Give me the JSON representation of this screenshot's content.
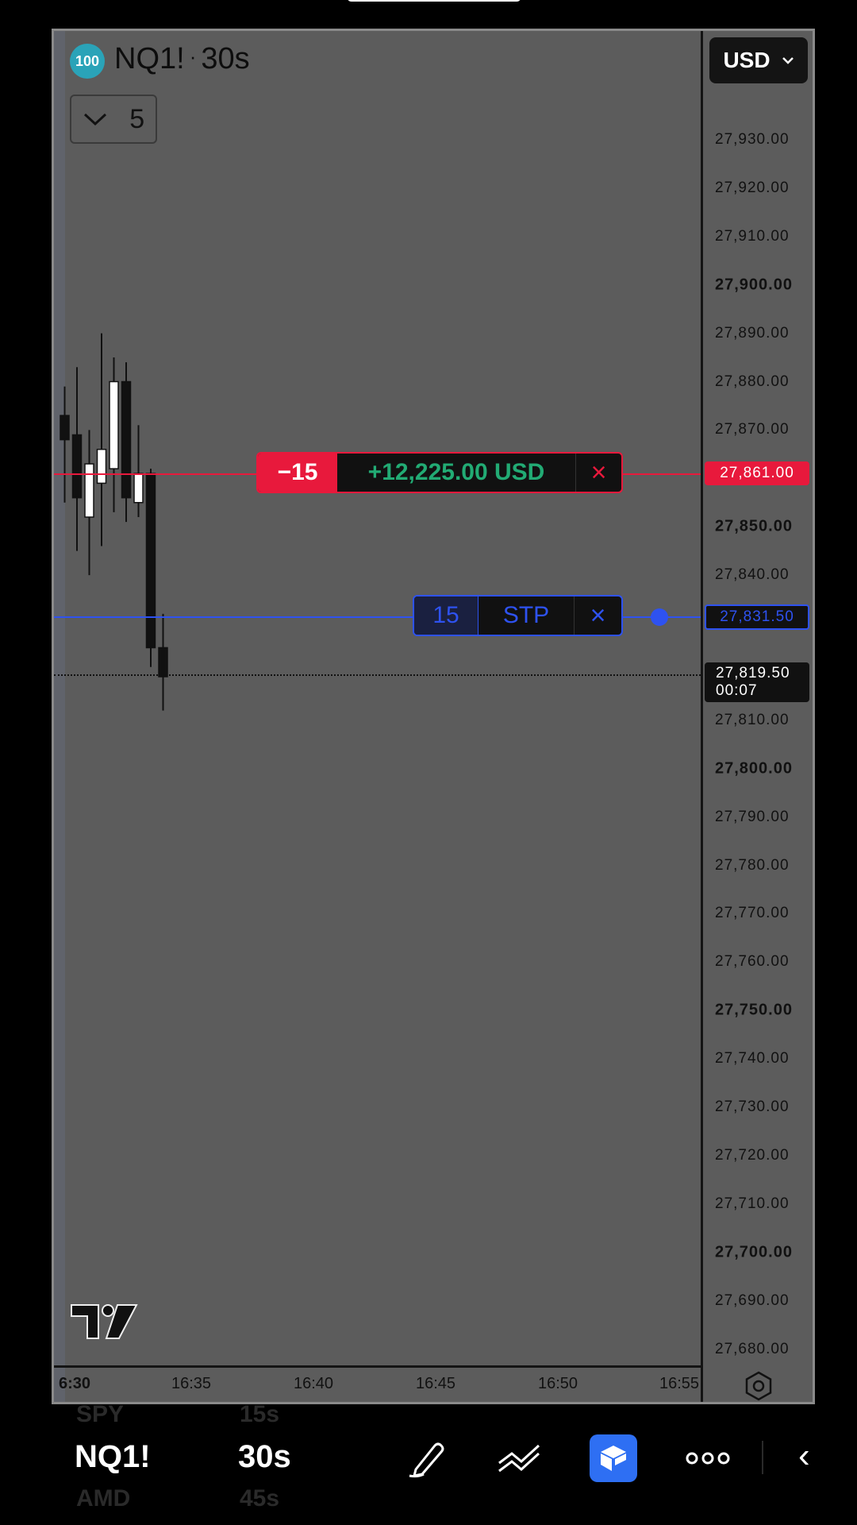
{
  "chart": {
    "symbol_badge": "100",
    "symbol": "NQ1!",
    "separator": "·",
    "interval": "30s",
    "indicators_count": "5",
    "currency": "USD",
    "price_labels": [
      {
        "text": "27,930.00",
        "bold": false
      },
      {
        "text": "27,920.00",
        "bold": false
      },
      {
        "text": "27,910.00",
        "bold": false
      },
      {
        "text": "27,900.00",
        "bold": true
      },
      {
        "text": "27,890.00",
        "bold": false
      },
      {
        "text": "27,880.00",
        "bold": false
      },
      {
        "text": "27,870.00",
        "bold": false
      },
      {
        "text": "27,850.00",
        "bold": true
      },
      {
        "text": "27,840.00",
        "bold": false
      },
      {
        "text": "27,810.00",
        "bold": false
      },
      {
        "text": "27,800.00",
        "bold": true
      },
      {
        "text": "27,790.00",
        "bold": false
      },
      {
        "text": "27,780.00",
        "bold": false
      },
      {
        "text": "27,770.00",
        "bold": false
      },
      {
        "text": "27,760.00",
        "bold": false
      },
      {
        "text": "27,750.00",
        "bold": true
      },
      {
        "text": "27,740.00",
        "bold": false
      },
      {
        "text": "27,730.00",
        "bold": false
      },
      {
        "text": "27,720.00",
        "bold": false
      },
      {
        "text": "27,710.00",
        "bold": false
      },
      {
        "text": "27,700.00",
        "bold": true
      },
      {
        "text": "27,690.00",
        "bold": false
      },
      {
        "text": "27,680.00",
        "bold": false
      }
    ],
    "time_labels": [
      {
        "text": "6:30",
        "bold": true
      },
      {
        "text": "16:35",
        "bold": false
      },
      {
        "text": "16:40",
        "bold": false
      },
      {
        "text": "16:45",
        "bold": false
      },
      {
        "text": "16:50",
        "bold": false
      },
      {
        "text": "16:55",
        "bold": false
      }
    ],
    "position": {
      "quantity": "−15",
      "pnl": "+12,225.00 USD",
      "close": "×",
      "price_tag": "27,861.00",
      "color": "#e8193c",
      "pnl_color": "#22ab74"
    },
    "stop_order": {
      "quantity": "15",
      "type": "STP",
      "close": "×",
      "price_tag": "27,831.50",
      "color": "#2e52f0"
    },
    "last_price": {
      "price": "27,819.50",
      "countdown": "00:07"
    },
    "candles": [
      {
        "open": 27873,
        "high": 27879,
        "low": 27855,
        "close": 27868
      },
      {
        "open": 27869,
        "high": 27883,
        "low": 27845,
        "close": 27856
      },
      {
        "open": 27852,
        "high": 27870,
        "low": 27840,
        "close": 27863
      },
      {
        "open": 27859,
        "high": 27890,
        "low": 27846,
        "close": 27866
      },
      {
        "open": 27862,
        "high": 27885,
        "low": 27853,
        "close": 27880
      },
      {
        "open": 27880,
        "high": 27884,
        "low": 27851,
        "close": 27856
      },
      {
        "open": 27855,
        "high": 27871,
        "low": 27852,
        "close": 27861
      },
      {
        "open": 27861,
        "high": 27862,
        "low": 27821,
        "close": 27825
      },
      {
        "open": 27825,
        "high": 27832,
        "low": 27812,
        "close": 27819
      }
    ]
  },
  "toolbar": {
    "symbol_prev": "SPY",
    "symbol": "NQ1!",
    "symbol_next": "AMD",
    "interval_prev": "15s",
    "interval": "30s",
    "interval_next": "45s",
    "tools": [
      "pen-icon",
      "trend-lines-icon",
      "trading-panel-icon",
      "more-icon"
    ],
    "back": "‹"
  }
}
